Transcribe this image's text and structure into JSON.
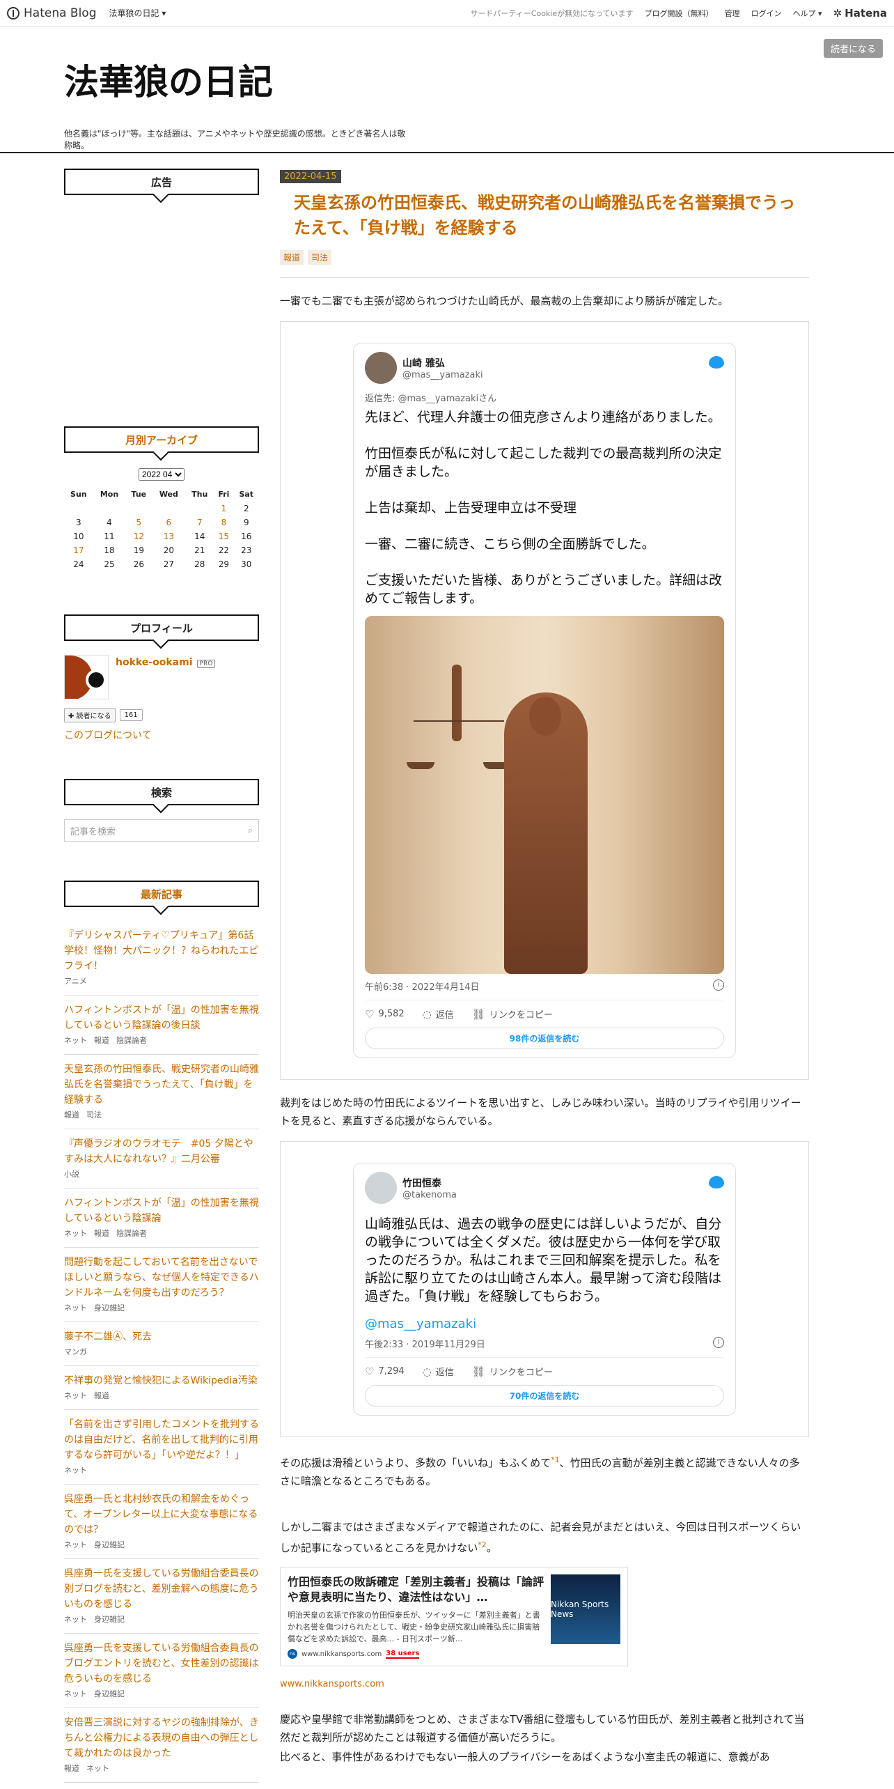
{
  "topbar": {
    "logo": "Hatena Blog",
    "blog_menu": "法華狼の日記 ▾",
    "cookie": "サードパーティーCookieが無効になっています",
    "open_blog": "ブログ開設（無料）",
    "manage": "管理",
    "login": "ログイン",
    "help": "ヘルプ ▾",
    "hatena": "Hatena"
  },
  "header": {
    "title": "法華狼の日記",
    "desc": "他名義は\"ほっけ\"等。主な話題は、アニメやネットや歴史認識の感想。ときどき著名人は敬称略。",
    "subscribe": "読者になる"
  },
  "sidebar": {
    "ad_title": "広告",
    "archive_title": "月別アーカイブ",
    "archive_select": "2022 04",
    "cal_head": [
      "Sun",
      "Mon",
      "Tue",
      "Wed",
      "Thu",
      "Fri",
      "Sat"
    ],
    "cal_rows": [
      [
        "",
        "",
        "",
        "",
        "",
        "1",
        "2"
      ],
      [
        "3",
        "4",
        "5",
        "6",
        "7",
        "8",
        "9"
      ],
      [
        "10",
        "11",
        "12",
        "13",
        "14",
        "15",
        "16"
      ],
      [
        "17",
        "18",
        "19",
        "20",
        "21",
        "22",
        "23"
      ],
      [
        "24",
        "25",
        "26",
        "27",
        "28",
        "29",
        "30"
      ]
    ],
    "cal_links": [
      "1",
      "5",
      "6",
      "7",
      "8",
      "12",
      "13",
      "15",
      "17"
    ],
    "profile_title": "プロフィール",
    "profile_name": "hokke-ookami",
    "pro": "PRO",
    "reader_btn": "✚ 読者になる",
    "reader_count": "161",
    "about": "このブログについて",
    "search_title": "検索",
    "search_placeholder": "記事を検索",
    "recent_title": "最新記事",
    "recent": [
      {
        "title": "『デリシャスパーティ♡プリキュア』第6話　学校！怪物！大パニック！？ねらわれたエピフライ！",
        "cats": [
          "アニメ"
        ]
      },
      {
        "title": "ハフィントンポストが「温」の性加害を無視しているという陰謀論の後日談",
        "cats": [
          "ネット",
          "報道",
          "陰謀論者"
        ]
      },
      {
        "title": "天皇玄孫の竹田恒泰氏、戦史研究者の山崎雅弘氏を名誉棄損でうったえて、「負け戦」を経験する",
        "cats": [
          "報道",
          "司法"
        ]
      },
      {
        "title": "『声優ラジオのウラオモテ　#05 夕陽とやすみは大人になれない？』二月公審",
        "cats": [
          "小説"
        ]
      },
      {
        "title": "ハフィントンポストが「温」の性加害を無視しているという陰謀論",
        "cats": [
          "ネット",
          "報道",
          "陰謀論者"
        ]
      },
      {
        "title": "問題行動を起こしておいて名前を出さないでほしいと願うなら、なぜ個人を特定できるハンドルネームを何度も出すのだろう？",
        "cats": [
          "ネット",
          "身辺雑記"
        ]
      },
      {
        "title": "藤子不二雄Ⓐ、死去",
        "cats": [
          "マンガ"
        ]
      },
      {
        "title": "不祥事の発覚と愉快犯によるWikipedia汚染",
        "cats": [
          "ネット",
          "報道"
        ]
      },
      {
        "title": "「名前を出さず引用したコメントを批判するのは自由だけど、名前を出して批判的に引用するなら許可がいる」「いや逆だよ？！」",
        "cats": [
          "ネット"
        ]
      },
      {
        "title": "呉座勇一氏と北村紗衣氏の和解金をめぐって、オープンレター以上に大変な事態になるのでは？",
        "cats": [
          "ネット",
          "身辺雑記"
        ]
      },
      {
        "title": "呉座勇一氏を支援している労働組合委員長の別ブログを読むと、差別金解への態度に危ういものを感じる",
        "cats": [
          "ネット",
          "身辺雑記"
        ]
      },
      {
        "title": "呉座勇一氏を支援している労働組合委員長のブログエントリを読むと、女性差別の認識は危ういものを感じる",
        "cats": [
          "ネット",
          "身辺雑記"
        ]
      },
      {
        "title": "安倍晋三演説に対するヤジの強制排除が、きちんと公権力による表現の自由への弾圧として裁かれたのは良かった",
        "cats": [
          "報道",
          "ネット"
        ]
      }
    ]
  },
  "entry": {
    "date": "2022-04-15",
    "title": "天皇玄孫の竹田恒泰氏、戦史研究者の山崎雅弘氏を名誉棄損でうったえて、「負け戦」を経験する",
    "cats": [
      "報道",
      "司法"
    ],
    "p1": "一審でも二審でも主張が認められつづけた山崎氏が、最高裁の上告棄却により勝訴が確定した。",
    "tweet1": {
      "name": "山崎 雅弘",
      "handle": "@mas__yamazaki",
      "reply": "返信先: @mas__yamazakiさん",
      "text": "先ほど、代理人弁護士の佃克彦さんより連絡がありました。\n\n竹田恒泰氏が私に対して起こした裁判での最高裁判所の決定が届きました。\n\n上告は棄却、上告受理申立は不受理\n\n一審、二審に続き、こちら側の全面勝訴でした。\n\nご支援いただいた皆様、ありがとうございました。詳細は改めてご報告します。",
      "time": "午前6:38 · 2022年4月14日",
      "likes": "9,582",
      "reply_label": "返信",
      "copy": "リンクをコピー",
      "read": "98件の返信を読む"
    },
    "p2": "裁判をはじめた時の竹田氏によるツイートを思い出すと、しみじみ味わい深い。当時のリプライや引用リツイートを見ると、素直すぎる応援がならんでいる。",
    "tweet2": {
      "name": "竹田恒泰",
      "handle": "@takenoma",
      "text": "山崎雅弘氏は、過去の戦争の歴史には詳しいようだが、自分の戦争については全くダメだ。彼は歴史から一体何を学び取ったのだろうか。私はこれまで三回和解案を提示した。私を訴訟に駆り立てたのは山崎さん本人。最早謝って済む段階は過ぎた。「負け戦」を経験してもらおう。",
      "mention": "@mas__yamazaki",
      "time": "午後2:33 · 2019年11月29日",
      "likes": "7,294",
      "reply_label": "返信",
      "copy": "リンクをコピー",
      "read": "70件の返信を読む"
    },
    "p3a": "その応援は滑稽というより、多数の「いいね」もふくめて",
    "fn1": "*1",
    "p3b": "、竹田氏の言動が差別主義と認識できない人々の多さに暗澹となるところでもある。",
    "p4a": "しかし二審まではさまざまなメディアで報道されたのに、記者会見がまだとはいえ、今回は日刊スポーツくらいしか記事になっているところを見かけない",
    "fn2": "*2",
    "p4b": "。",
    "card": {
      "title": "竹田恒泰氏の敗訴確定「差別主義者」投稿は「論評や意見表明に当たり、違法性はない」…",
      "desc": "明治天皇の玄孫で作家の竹田恒泰氏が、ツイッターに「差別主義者」と書かれ名誉を傷つけられたとして、戦史・紛争史研究家山崎雅弘氏に損害賠償などを求めた訴訟で、最高... - 日刊スポーツ新...",
      "site": "www.nikkansports.com",
      "users": "38 users",
      "img": "Nikkan Sports News"
    },
    "src_link": "www.nikkansports.com",
    "p5": "慶応や皇學館で非常勤講師をつとめ、さまざまなTV番組に登壇もしている竹田氏が、差別主義者と批判されて当然だと裁判所が認めたことは報道する価値が高いだろうに。",
    "p6": "比べると、事件性があるわけでもない一般人のプライバシーをあばくような小室圭氏の報道に、意義があ"
  }
}
